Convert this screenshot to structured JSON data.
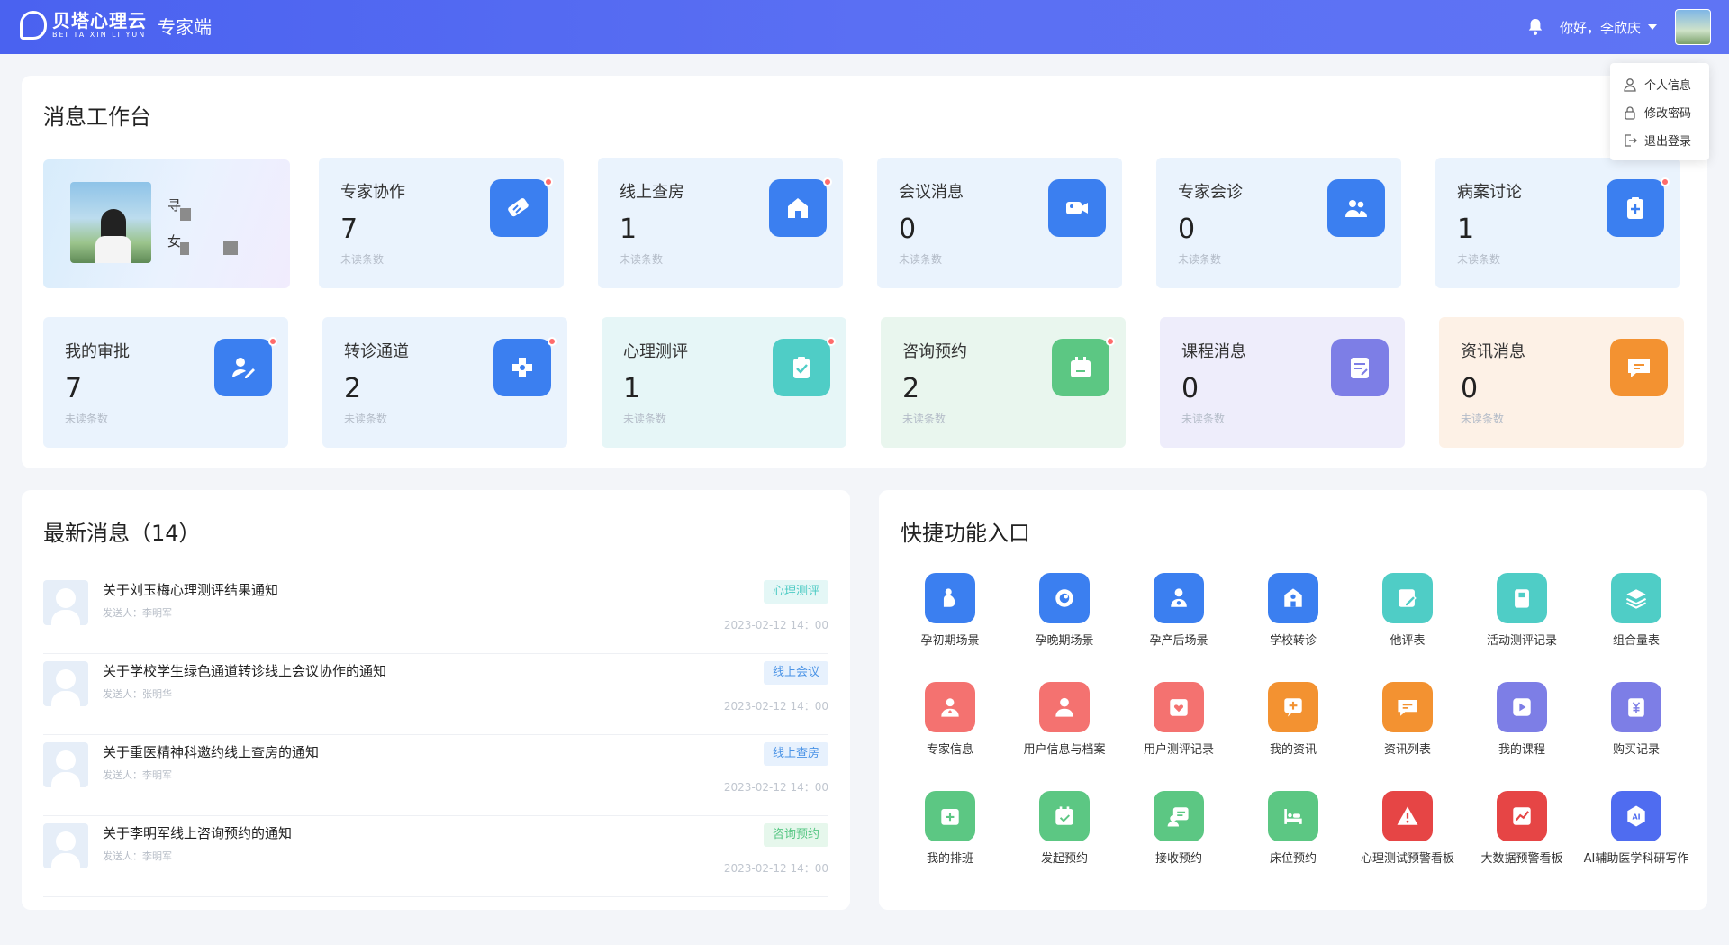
{
  "header": {
    "logo_cn": "贝塔心理云",
    "logo_en": "BEI TA XIN LI YUN",
    "portal": "专家端",
    "greeting": "你好，李欣庆"
  },
  "user_menu": [
    {
      "label": "个人信息",
      "icon": "user-icon"
    },
    {
      "label": "修改密码",
      "icon": "lock-icon"
    },
    {
      "label": "退出登录",
      "icon": "logout-icon"
    }
  ],
  "workbench": {
    "title": "消息工作台",
    "profile": {
      "name": "寻",
      "gender": "女"
    },
    "cards_row1": [
      {
        "name": "专家协作",
        "count": "7",
        "sub": "未读条数",
        "color": "#3b7ff0",
        "dot": true,
        "icon": "handshake-icon"
      },
      {
        "name": "线上查房",
        "count": "1",
        "sub": "未读条数",
        "color": "#3b7ff0",
        "dot": true,
        "icon": "home-icon"
      },
      {
        "name": "会议消息",
        "count": "0",
        "sub": "未读条数",
        "color": "#3b7ff0",
        "dot": false,
        "icon": "video-icon"
      },
      {
        "name": "专家会诊",
        "count": "0",
        "sub": "未读条数",
        "color": "#3b7ff0",
        "dot": false,
        "icon": "group-icon"
      },
      {
        "name": "病案讨论",
        "count": "1",
        "sub": "未读条数",
        "color": "#3b7ff0",
        "dot": true,
        "icon": "clipboard-plus-icon"
      }
    ],
    "cards_row2": [
      {
        "name": "我的审批",
        "count": "7",
        "sub": "未读条数",
        "color": "#3b7ff0",
        "bg": "#eaf3fd",
        "dot": true,
        "icon": "approval-icon"
      },
      {
        "name": "转诊通道",
        "count": "2",
        "sub": "未读条数",
        "color": "#3b7ff0",
        "bg": "#eaf3fd",
        "dot": true,
        "icon": "medical-cross-icon"
      },
      {
        "name": "心理测评",
        "count": "1",
        "sub": "未读条数",
        "color": "#4fcdc6",
        "bg": "#e6f6f7",
        "dot": true,
        "icon": "check-clipboard-icon"
      },
      {
        "name": "咨询预约",
        "count": "2",
        "sub": "未读条数",
        "color": "#5cc783",
        "bg": "#e9f6ee",
        "dot": true,
        "icon": "calendar-icon"
      },
      {
        "name": "课程消息",
        "count": "0",
        "sub": "未读条数",
        "color": "#7d7ee6",
        "bg": "#eeedfb",
        "dot": false,
        "icon": "note-icon"
      },
      {
        "name": "资讯消息",
        "count": "0",
        "sub": "未读条数",
        "color": "#f39231",
        "bg": "#fdf1e6",
        "dot": false,
        "icon": "chat-icon"
      }
    ]
  },
  "latest": {
    "title": "最新消息（14）",
    "messages": [
      {
        "title": "关于刘玉梅心理测评结果通知",
        "sender": "发送人：李明军",
        "tag": "心理测评",
        "tag_class": "tag-cyan",
        "time": "2023-02-12 14：00"
      },
      {
        "title": "关于学校学生绿色通道转诊线上会议协作的通知",
        "sender": "发送人：张明华",
        "tag": "线上会议",
        "tag_class": "tag-blue",
        "time": "2023-02-12 14：00"
      },
      {
        "title": "关于重医精神科邀约线上查房的通知",
        "sender": "发送人：李明军",
        "tag": "线上查房",
        "tag_class": "tag-blue",
        "time": "2023-02-12 14：00"
      },
      {
        "title": "关于李明军线上咨询预约的通知",
        "sender": "发送人：李明军",
        "tag": "咨询预约",
        "tag_class": "tag-green",
        "time": "2023-02-12 14：00"
      }
    ]
  },
  "quick": {
    "title": "快捷功能入口",
    "rows": [
      [
        {
          "label": "孕初期场景",
          "color": "#3b7ff0",
          "icon": "pregnant-icon"
        },
        {
          "label": "孕晚期场景",
          "color": "#3b7ff0",
          "icon": "baby-icon"
        },
        {
          "label": "孕产后场景",
          "color": "#3b7ff0",
          "icon": "mother-icon"
        },
        {
          "label": "学校转诊",
          "color": "#3b7ff0",
          "icon": "school-icon"
        },
        {
          "label": "他评表",
          "color": "#4fcdc6",
          "icon": "edit-icon"
        },
        {
          "label": "活动测评记录",
          "color": "#4fcdc6",
          "icon": "record-icon"
        },
        {
          "label": "组合量表",
          "color": "#4fcdc6",
          "icon": "layers-icon"
        }
      ],
      [
        {
          "label": "专家信息",
          "color": "#f47270",
          "icon": "doctor-icon"
        },
        {
          "label": "用户信息与档案",
          "color": "#f47270",
          "icon": "profile-icon"
        },
        {
          "label": "用户测评记录",
          "color": "#f47270",
          "icon": "heart-card-icon"
        },
        {
          "label": "我的资讯",
          "color": "#f39231",
          "icon": "news-icon"
        },
        {
          "label": "资讯列表",
          "color": "#f39231",
          "icon": "message-list-icon"
        },
        {
          "label": "我的课程",
          "color": "#7d7ee6",
          "icon": "play-icon"
        },
        {
          "label": "购买记录",
          "color": "#7d7ee6",
          "icon": "yuan-icon"
        }
      ],
      [
        {
          "label": "我的排班",
          "color": "#5cc783",
          "icon": "schedule-icon"
        },
        {
          "label": "发起预约",
          "color": "#5cc783",
          "icon": "appointment-icon"
        },
        {
          "label": "接收预约",
          "color": "#5cc783",
          "icon": "receive-icon"
        },
        {
          "label": "床位预约",
          "color": "#5cc783",
          "icon": "bed-icon"
        },
        {
          "label": "心理测试预警看板",
          "color": "#e64545",
          "icon": "warning-icon"
        },
        {
          "label": "大数据预警看板",
          "color": "#e64545",
          "icon": "trend-icon"
        },
        {
          "label": "AI辅助医学科研写作",
          "color": "#4f6cf0",
          "icon": "ai-icon"
        }
      ]
    ]
  }
}
